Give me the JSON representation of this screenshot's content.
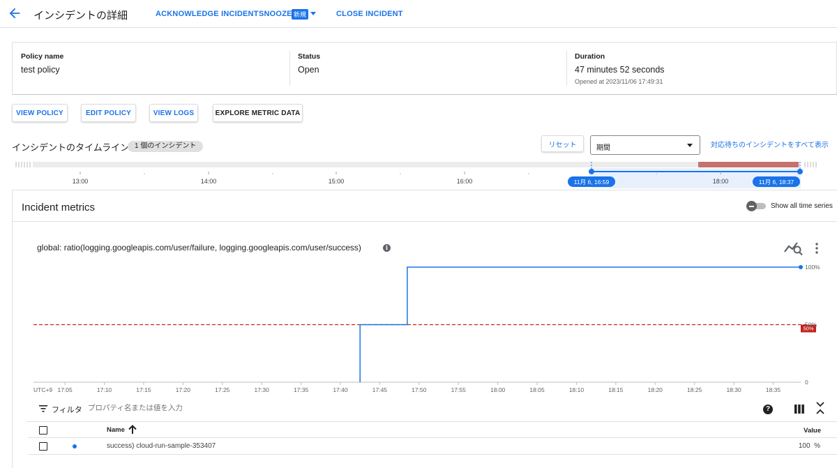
{
  "header": {
    "title": "インシデントの詳細",
    "actions": {
      "acknowledge": "ACKNOWLEDGE INCIDENT",
      "snooze": "SNOOZE",
      "snooze_badge": "新規",
      "close": "CLOSE INCIDENT"
    }
  },
  "summary": {
    "policy": {
      "label": "Policy name",
      "value": "test policy"
    },
    "status": {
      "label": "Status",
      "value": "Open"
    },
    "duration": {
      "label": "Duration",
      "value": "47 minutes 52 seconds",
      "sub": "Opened at 2023/11/06 17:49:31"
    }
  },
  "buttons": {
    "view_policy": "VIEW POLICY",
    "edit_policy": "EDIT POLICY",
    "view_logs": "VIEW LOGS",
    "explore": "EXPLORE METRIC DATA"
  },
  "timeline": {
    "title": "インシデントのタイムライン",
    "count_chip": "1 個のインシデント",
    "reset": "リセット",
    "period_label": "期間",
    "show_all_link": "対応待ちのインシデントをすべて表示",
    "ticks": [
      "13:00",
      "14:00",
      "15:00",
      "16:00",
      "18:00"
    ],
    "range_start": "11月 6, 16:59",
    "range_end": "11月 6, 18:37",
    "accent": "#1a73e8",
    "incident_color": "#c5726d"
  },
  "metrics": {
    "title": "Incident metrics",
    "toggle_label": "Show all time series",
    "toggle_on": false,
    "chart_title": "global: ratio(logging.googleapis.com/user/failure, logging.googleapis.com/user/success)",
    "filter": {
      "label": "フィルタ",
      "placeholder": "プロパティ名または値を入力"
    },
    "table": {
      "headers": {
        "name": "Name",
        "value": "Value"
      },
      "rows": [
        {
          "name": "success) cloud-run-sample-353407",
          "value": "100",
          "unit": "%"
        }
      ]
    }
  },
  "chart_data": {
    "type": "line",
    "title": "global: ratio(logging.googleapis.com/user/failure, logging.googleapis.com/user/success)",
    "timezone_label": "UTC+9",
    "x_ticks": [
      "17:05",
      "17:10",
      "17:15",
      "17:20",
      "17:25",
      "17:30",
      "17:35",
      "17:40",
      "17:45",
      "17:50",
      "17:55",
      "18:00",
      "18:05",
      "18:10",
      "18:15",
      "18:20",
      "18:25",
      "18:30",
      "18:35"
    ],
    "x_range_minutes": [
      1021,
      1118.5
    ],
    "y_ticks": [
      "0",
      "50%",
      "100%"
    ],
    "ylim": [
      0,
      100
    ],
    "threshold": {
      "value": 50,
      "label": "50%",
      "color": "#c5221f"
    },
    "series": [
      {
        "color": "#1a73e8",
        "points": [
          [
            1062.5,
            0
          ],
          [
            1062.5,
            50
          ],
          [
            1068.5,
            50
          ],
          [
            1068.5,
            100
          ],
          [
            1118.5,
            100
          ]
        ]
      }
    ]
  }
}
